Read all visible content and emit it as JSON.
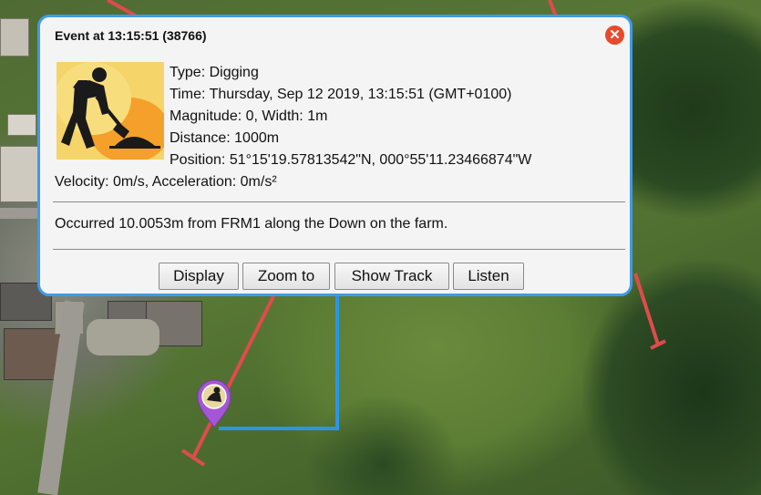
{
  "popup": {
    "title": "Event at 13:15:51 (38766)",
    "close_icon": "close-circle-icon",
    "event_icon": "digging-worker-icon",
    "type": "Type: Digging",
    "time": "Time: Thursday, Sep 12 2019, 13:15:51 (GMT+0100)",
    "magnitude": "Magnitude: 0, Width: 1m",
    "distance": "Distance: 1000m",
    "position": "Position: 51°15'19.57813542\"N, 000°55'11.23466874\"W",
    "velocity": "Velocity: 0m/s, Acceleration: 0m/s²",
    "occurred": "Occurred 10.0053m from FRM1 along the Down on the farm.",
    "buttons": {
      "display": "Display",
      "zoom_to": "Zoom to",
      "show_track": "Show Track",
      "listen": "Listen"
    }
  },
  "map": {
    "marker_icon": "map-pin-icon",
    "route_color": "#2b95e6",
    "fibre_color": "#e04b4b",
    "marker_color": "#a357d6"
  }
}
